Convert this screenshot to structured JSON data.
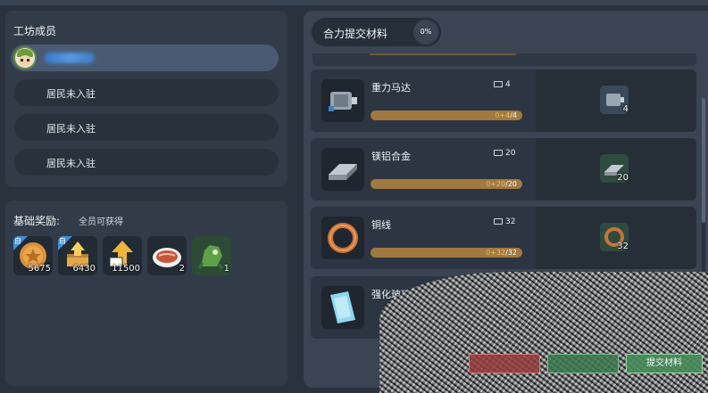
{
  "members": {
    "title": "工坊成员",
    "vacant_slots": [
      "居民未入驻",
      "居民未入驻",
      "居民未入驻"
    ]
  },
  "rewards": {
    "title": "基础奖励:",
    "subtitle": "全员可获得",
    "items": [
      {
        "icon": "gold-coin-icon",
        "qty": "5675",
        "badge": true
      },
      {
        "icon": "treasure-chest-icon",
        "qty": "6430",
        "badge": true
      },
      {
        "icon": "level-up-arrow-icon",
        "qty": "11500",
        "badge": false
      },
      {
        "icon": "meat-dish-icon",
        "qty": "2",
        "badge": false
      },
      {
        "icon": "green-creature-icon",
        "qty": "1",
        "badge": false
      }
    ]
  },
  "submit": {
    "title": "合力提交材料",
    "progress": "0%",
    "materials": [
      {
        "name": "重力马达",
        "stock": "4",
        "current": "0",
        "required": "4",
        "icon": "motor-icon"
      },
      {
        "name": "镁铝合金",
        "stock": "20",
        "current": "0",
        "required": "20",
        "icon": "ingot-icon"
      },
      {
        "name": "铜线",
        "stock": "32",
        "current": "0",
        "required": "32",
        "icon": "copper-coil-icon"
      },
      {
        "name": "强化玻璃",
        "icon": "glass-pane-icon"
      }
    ],
    "buttons": {
      "submit_label": "提交材料"
    }
  },
  "colors": {
    "panel": "#323c48",
    "accent_bar": "#a07a40",
    "progress_text": "#f6c064"
  }
}
